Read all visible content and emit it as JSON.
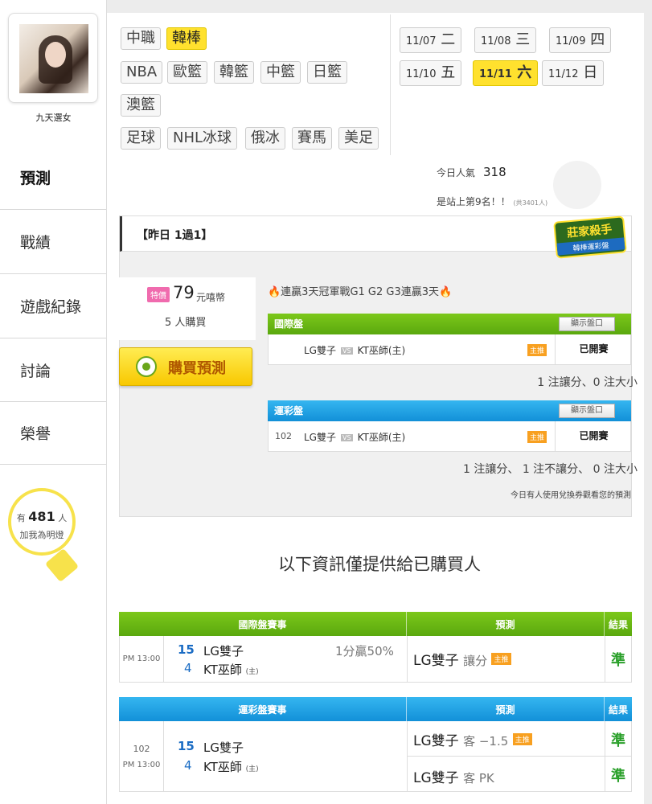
{
  "user": {
    "name": "九天選女"
  },
  "sidebar": {
    "items": [
      {
        "label": "預測"
      },
      {
        "label": "戰績"
      },
      {
        "label": "遊戲紀錄"
      },
      {
        "label": "討論"
      },
      {
        "label": "榮譽"
      }
    ]
  },
  "fans": {
    "prefix": "有",
    "count": "481",
    "unit": "人",
    "line2": "加我為明燈"
  },
  "filters": {
    "row1": [
      "中職",
      "韓棒"
    ],
    "row2": [
      "NBA",
      "歐籃",
      "韓籃",
      "中籃",
      "日籃"
    ],
    "row3": [
      "澳籃"
    ],
    "row4": [
      "足球",
      "NHL冰球",
      "俄冰",
      "賽馬",
      "美足"
    ],
    "active": "韓棒"
  },
  "dates": [
    {
      "d": "11/07",
      "w": "二"
    },
    {
      "d": "11/08",
      "w": "三"
    },
    {
      "d": "11/09",
      "w": "四"
    },
    {
      "d": "11/10",
      "w": "五"
    },
    {
      "d": "11/11",
      "w": "六"
    },
    {
      "d": "11/12",
      "w": "日"
    }
  ],
  "stats": {
    "popularity_label": "今日人氣",
    "popularity": "318",
    "rank_text": "是站上第9名！！",
    "rank_total": "(共3401人)"
  },
  "panel": {
    "title": "【昨日 1過1】",
    "badge_title": "莊家殺手",
    "badge_sub": "韓棒運彩盤",
    "price_tag": "特價",
    "price": "79",
    "price_unit": "元嘻幣",
    "buyers": "5 人購買",
    "buy_label": "購買預測",
    "headline": "🔥連贏3天冠軍戰G1 G2 G3連贏3天🔥",
    "intl": {
      "title": "國際盤",
      "show_btn": "顯示盤口",
      "code": "",
      "team_a": "LG雙子",
      "vs": "VS",
      "team_b": "KT巫師(主)",
      "host_tag": "主推",
      "status": "已開賽",
      "summary": "1 注讓分、0 注大小"
    },
    "lottery": {
      "title": "運彩盤",
      "show_btn": "顯示盤口",
      "code": "102",
      "team_a": "LG雙子",
      "vs": "VS",
      "team_b": "KT巫師(主)",
      "host_tag": "主推",
      "status": "已開賽",
      "summary": "1 注讓分、 1 注不讓分、 0 注大小"
    },
    "coupon_note": "今日有人使用兌換券觀看您的預測"
  },
  "section_title": "以下資訊僅提供給已購買人",
  "intl_table": {
    "headers": [
      "國際盤賽事",
      "預測",
      "結果"
    ],
    "row": {
      "time_a": "PM 13:00",
      "score_a": "15",
      "team_a": "LG雙子",
      "odds": "1分贏50%",
      "score_b": "4",
      "team_b": "KT巫師",
      "host": "(主)",
      "pred_team": "LG雙子",
      "pred_sub": "讓分",
      "tag": "主推",
      "result": "準"
    }
  },
  "lottery_table": {
    "headers": [
      "運彩盤賽事",
      "預測",
      "結果"
    ],
    "row": {
      "code": "102",
      "time_a": "PM 13:00",
      "score_a": "15",
      "team_a": "LG雙子",
      "score_b": "4",
      "team_b": "KT巫師",
      "host": "(主)",
      "preds": [
        {
          "team": "LG雙子",
          "sub": "客 −1.5",
          "tag": "主推",
          "result": "準"
        },
        {
          "team": "LG雙子",
          "sub": "客 PK",
          "tag": "",
          "result": "準"
        }
      ]
    }
  }
}
